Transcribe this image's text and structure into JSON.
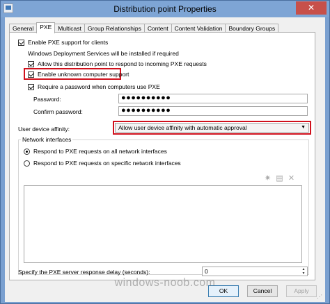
{
  "window": {
    "title": "Distribution point Properties",
    "close_glyph": "✕"
  },
  "tabs": [
    {
      "label": "General",
      "active": false
    },
    {
      "label": "PXE",
      "active": true
    },
    {
      "label": "Multicast",
      "active": false
    },
    {
      "label": "Group Relationships",
      "active": false
    },
    {
      "label": "Content",
      "active": false
    },
    {
      "label": "Content Validation",
      "active": false
    },
    {
      "label": "Boundary Groups",
      "active": false
    }
  ],
  "pxe": {
    "enable_pxe": {
      "label": "Enable PXE support for clients",
      "checked": true
    },
    "wds_note": "Windows Deployment Services will be installed if required",
    "allow_respond": {
      "label": "Allow this distribution point to respond to incoming PXE requests",
      "checked": true
    },
    "unknown_support": {
      "label": "Enable unknown computer support",
      "checked": true
    },
    "require_password": {
      "label": "Require a password when computers use PXE",
      "checked": true
    },
    "password": {
      "label": "Password:",
      "value": "●●●●●●●●●●"
    },
    "confirm_password": {
      "label": "Confirm password:",
      "value": "●●●●●●●●●●"
    },
    "affinity": {
      "label": "User device affinity:",
      "value": "Allow user device affinity with automatic approval",
      "arrow": "▼"
    },
    "network": {
      "legend": "Network interfaces",
      "all": {
        "label": "Respond to PXE requests on all network interfaces",
        "selected": true
      },
      "specific": {
        "label": "Respond to PXE requests on specific network interfaces",
        "selected": false
      },
      "toolbar": {
        "add": "✷",
        "properties": "▤",
        "delete": "✕"
      }
    },
    "delay": {
      "label": "Specify the PXE server response delay (seconds):",
      "value": "0",
      "up": "▲",
      "down": "▼"
    }
  },
  "buttons": {
    "ok": "OK",
    "cancel": "Cancel",
    "apply": "Apply"
  },
  "watermark": "windows-noob.com",
  "colors": {
    "highlight": "#d0101c",
    "titlebar": "#7ea5d5",
    "close": "#c7504a"
  }
}
